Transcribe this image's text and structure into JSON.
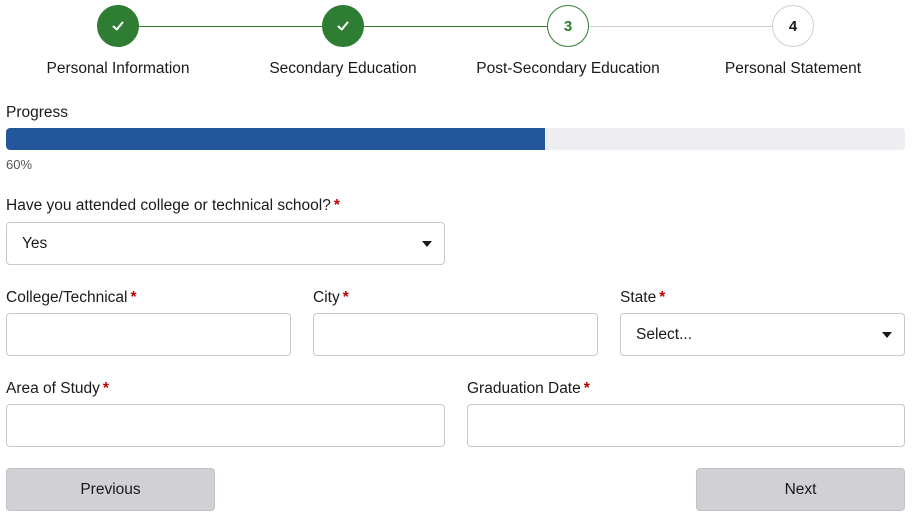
{
  "stepper": {
    "steps": [
      {
        "label": "Personal Information",
        "status": "complete",
        "icon": "check-icon"
      },
      {
        "label": "Secondary Education",
        "status": "complete",
        "icon": "check-icon"
      },
      {
        "label": "Post-Secondary Education",
        "number": "3",
        "status": "current"
      },
      {
        "label": "Personal Statement",
        "number": "4",
        "status": "upcoming"
      }
    ]
  },
  "progress": {
    "label": "Progress",
    "value_text": "60%",
    "value": 0.6
  },
  "form": {
    "attended": {
      "label": "Have you attended college or technical school?",
      "required_mark": "*",
      "selected": "Yes"
    },
    "college": {
      "label": "College/Technical",
      "required_mark": "*",
      "value": ""
    },
    "city": {
      "label": "City",
      "required_mark": "*",
      "value": ""
    },
    "state": {
      "label": "State",
      "required_mark": "*",
      "selected": "Select..."
    },
    "area_of_study": {
      "label": "Area of Study",
      "required_mark": "*",
      "value": ""
    },
    "graduation_date": {
      "label": "Graduation Date",
      "required_mark": "*",
      "value": ""
    }
  },
  "buttons": {
    "previous": "Previous",
    "next": "Next"
  },
  "colors": {
    "complete": "#2e7d32",
    "progress_fill": "#23569b",
    "progress_track": "#ededf2",
    "required": "#c00000",
    "button_bg": "#d0d0d5"
  }
}
